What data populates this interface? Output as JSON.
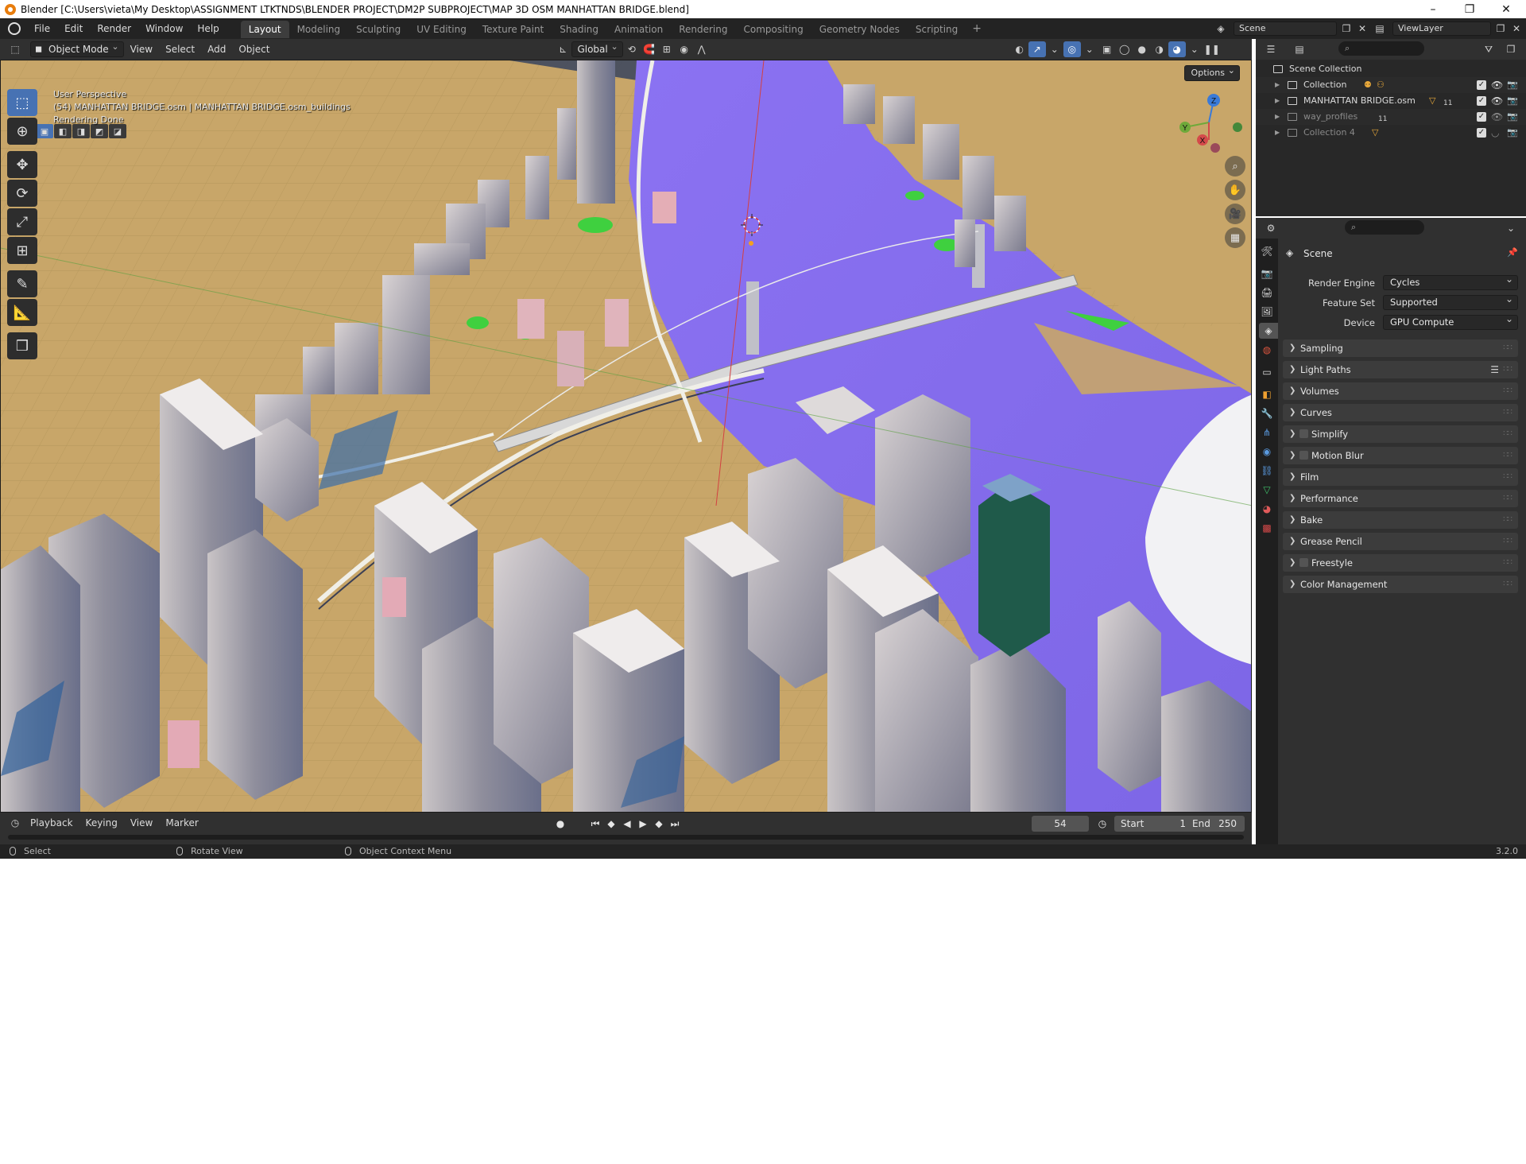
{
  "window": {
    "title": "Blender [C:\\Users\\vieta\\My Desktop\\ASSIGNMENT LTKTNDS\\BLENDER PROJECT\\DM2P SUBPROJECT\\MAP 3D OSM MANHATTAN BRIDGE.blend]",
    "minimize": "–",
    "restore": "❐",
    "close": "✕"
  },
  "menubar": {
    "menus": [
      "File",
      "Edit",
      "Render",
      "Window",
      "Help"
    ],
    "workspaces": [
      "Layout",
      "Modeling",
      "Sculpting",
      "UV Editing",
      "Texture Paint",
      "Shading",
      "Animation",
      "Rendering",
      "Compositing",
      "Geometry Nodes",
      "Scripting"
    ],
    "active_workspace": "Layout",
    "add_workspace": "+",
    "scene": "Scene",
    "view_layer": "ViewLayer"
  },
  "viewport_header": {
    "mode": "Object Mode",
    "menus": [
      "View",
      "Select",
      "Add",
      "Object"
    ],
    "transform_orientation": "Global"
  },
  "viewport": {
    "info_line1": "User Perspective",
    "info_line2": "(54) MANHATTAN BRIDGE.osm | MANHATTAN BRIDGE.osm_buildings",
    "info_line3": "Rendering Done",
    "options": "Options",
    "gizmo_axes": [
      "Z",
      "Y",
      "X"
    ]
  },
  "timeline": {
    "menus": [
      "Playback",
      "Keying",
      "View",
      "Marker"
    ],
    "current_frame": "54",
    "start_label": "Start",
    "start": "1",
    "end_label": "End",
    "end": "250"
  },
  "statusbar": {
    "select": "Select",
    "rotate": "Rotate View",
    "context_menu": "Object Context Menu",
    "version": "3.2.0"
  },
  "outliner": {
    "root": "Scene Collection",
    "items": [
      {
        "name": "Collection",
        "dim": false
      },
      {
        "name": "MANHATTAN BRIDGE.osm",
        "dim": false,
        "badge": "11"
      },
      {
        "name": "way_profiles",
        "dim": true,
        "badge": "11"
      },
      {
        "name": "Collection 4",
        "dim": true
      }
    ]
  },
  "properties": {
    "context": "Scene",
    "render_engine_label": "Render Engine",
    "render_engine": "Cycles",
    "feature_set_label": "Feature Set",
    "feature_set": "Supported",
    "device_label": "Device",
    "device": "GPU Compute",
    "panels": [
      {
        "label": "Sampling",
        "checkbox": false
      },
      {
        "label": "Light Paths",
        "checkbox": false,
        "list_icon": true
      },
      {
        "label": "Volumes",
        "checkbox": false
      },
      {
        "label": "Curves",
        "checkbox": false
      },
      {
        "label": "Simplify",
        "checkbox": true
      },
      {
        "label": "Motion Blur",
        "checkbox": true
      },
      {
        "label": "Film",
        "checkbox": false
      },
      {
        "label": "Performance",
        "checkbox": false
      },
      {
        "label": "Bake",
        "checkbox": false
      },
      {
        "label": "Grease Pencil",
        "checkbox": false
      },
      {
        "label": "Freestyle",
        "checkbox": true
      },
      {
        "label": "Color Management",
        "checkbox": false
      }
    ]
  },
  "colors": {
    "accent": "#4772b3",
    "ground": "#c9a867",
    "water": "#8a6df0",
    "park": "#3fcf3f"
  }
}
